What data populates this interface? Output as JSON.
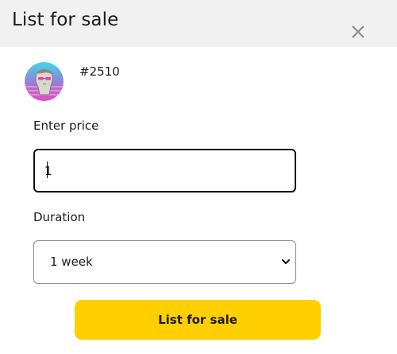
{
  "modal": {
    "title": "List for sale",
    "close_icon": "close-icon"
  },
  "item": {
    "avatar_icon": "nft-avatar",
    "token_id": "#2510"
  },
  "form": {
    "price_label": "Enter price",
    "price_value": "1",
    "duration_label": "Duration",
    "duration_selected": "1 week",
    "submit_label": "List for sale"
  },
  "colors": {
    "header_bg": "#f1f1f1",
    "accent": "#ffcf00",
    "input_border_focused": "#111111",
    "select_border": "#8a8a8a"
  }
}
